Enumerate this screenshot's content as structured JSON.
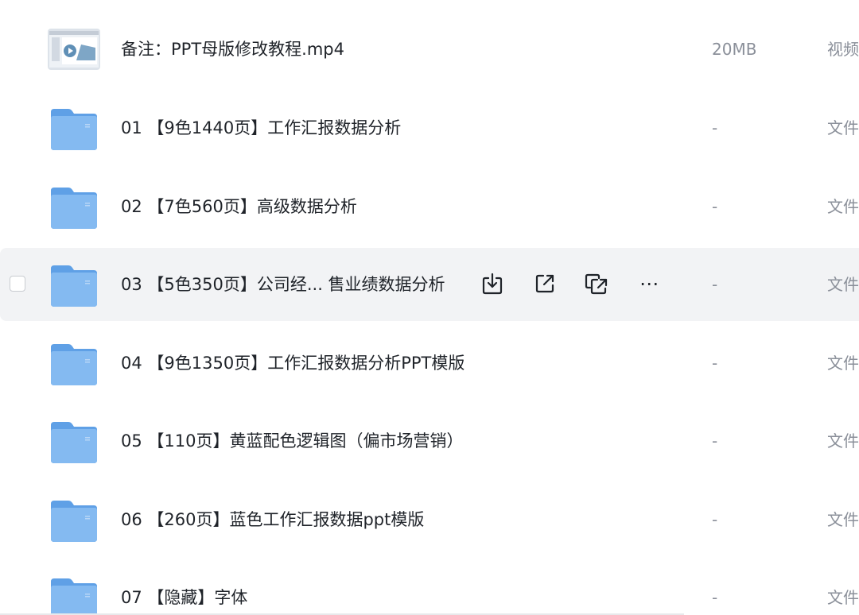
{
  "files": [
    {
      "name": "备注：PPT母版修改教程.mp4",
      "size": "20MB",
      "type": "视频",
      "icon": "video-thumbnail"
    },
    {
      "name": "01 【9色1440页】工作汇报数据分析",
      "size": "-",
      "type": "文件",
      "icon": "folder-icon"
    },
    {
      "name": "02 【7色560页】高级数据分析",
      "size": "-",
      "type": "文件",
      "icon": "folder-icon"
    },
    {
      "name": "03 【5色350页】公司经... 售业绩数据分析",
      "size": "-",
      "type": "文件",
      "icon": "folder-icon"
    },
    {
      "name": "04 【9色1350页】工作汇报数据分析PPT模版",
      "size": "-",
      "type": "文件",
      "icon": "folder-icon"
    },
    {
      "name": "05 【110页】黄蓝配色逻辑图（偏市场营销）",
      "size": "-",
      "type": "文件",
      "icon": "folder-icon"
    },
    {
      "name": "06 【260页】蓝色工作汇报数据ppt模版",
      "size": "-",
      "type": "文件",
      "icon": "folder-icon"
    },
    {
      "name": "07 【隐藏】字体",
      "size": "-",
      "type": "文件",
      "icon": "folder-icon"
    }
  ],
  "row_actions": {
    "download": "download-icon",
    "share": "share-icon",
    "copy_link": "copy-link-icon",
    "more": "⋯"
  },
  "colors": {
    "folder": "#7fb6f0",
    "folder_dark": "#5fa0e6",
    "hover_bg": "#f2f3f5",
    "text_primary": "#1f2329",
    "text_secondary": "#8a8f99"
  }
}
